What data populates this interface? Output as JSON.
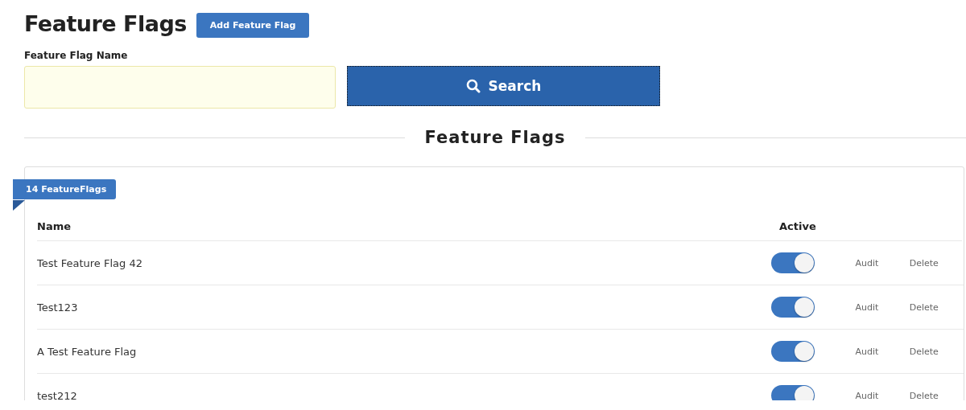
{
  "page_title": "Feature Flags",
  "add_button": "Add Feature Flag",
  "search": {
    "label": "Feature Flag Name",
    "button": "Search"
  },
  "section_title": "Feature Flags",
  "count_badge": "14 FeatureFlags",
  "table": {
    "columns": [
      "Name",
      "Active"
    ],
    "rows": [
      {
        "name": "Test Feature Flag 42",
        "active": true,
        "audit": "Audit",
        "delete": "Delete"
      },
      {
        "name": "Test123",
        "active": true,
        "audit": "Audit",
        "delete": "Delete"
      },
      {
        "name": "A Test Feature Flag",
        "active": true,
        "audit": "Audit",
        "delete": "Delete"
      },
      {
        "name": "test212",
        "active": true,
        "audit": "Audit",
        "delete": "Delete"
      }
    ]
  }
}
